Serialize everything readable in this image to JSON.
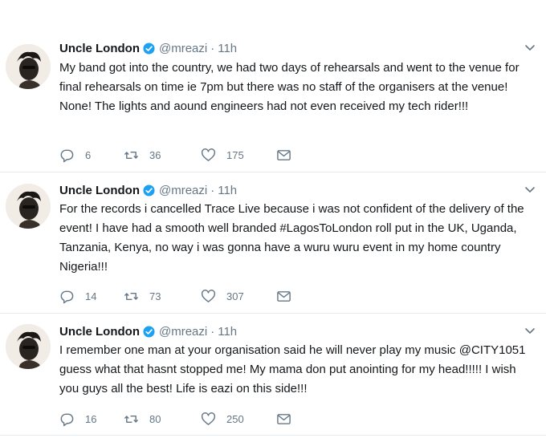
{
  "colors": {
    "text": "#14171a",
    "secondary": "#657786",
    "verified": "#1da1f2",
    "divider": "#e6ecf0"
  },
  "tweets": [
    {
      "author": "Uncle London",
      "handle": "@mreazi",
      "time": "11h",
      "text": "My band got into the country, we had two days of rehearsals and went to the venue for final rehearsals on time ie 7pm but there was no staff of the organisers at the venue! None! The lights and aound engineers had not even received my tech rider!!!",
      "replies": "6",
      "retweets": "36",
      "likes": "175"
    },
    {
      "author": "Uncle London",
      "handle": "@mreazi",
      "time": "11h",
      "text": "For the records i cancelled Trace Live because i was not confident of the delivery of the event! I have had a smooth well branded #LagosToLondon roll put in the UK, Uganda, Tanzania, Kenya, no way i was gonna have a wuru wuru event in my home country Nigeria!!!",
      "replies": "14",
      "retweets": "73",
      "likes": "307"
    },
    {
      "author": "Uncle London",
      "handle": "@mreazi",
      "time": "11h",
      "text": "I remember one man at your organisation said he will never play my music @CITY1051 guess what that hasnt stopped me! My mama don put anointing for my head!!!!! I wish you guys all the best! Life is eazi on this side!!!",
      "replies": "16",
      "retweets": "80",
      "likes": "250"
    }
  ],
  "separator": "·",
  "icons": {
    "avatar": "profile-photo",
    "verified": "verified-badge-icon",
    "caret": "chevron-down-icon",
    "reply": "reply-icon",
    "retweet": "retweet-icon",
    "like": "heart-icon",
    "dm": "envelope-icon"
  }
}
